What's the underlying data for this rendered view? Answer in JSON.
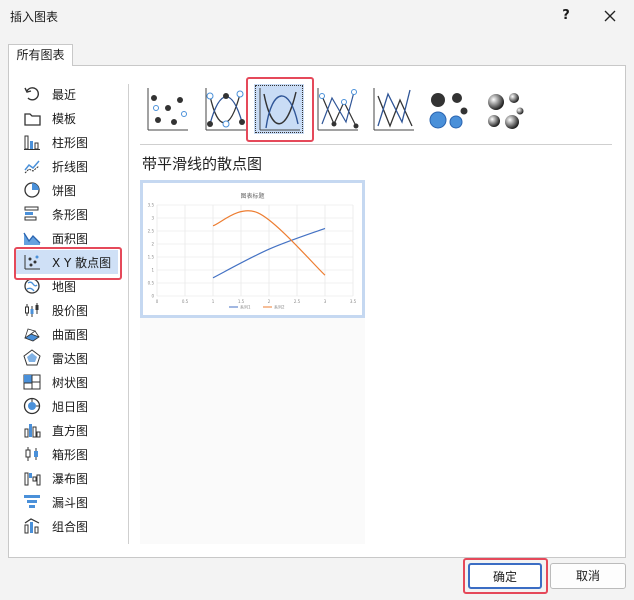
{
  "dialog": {
    "title": "插入图表",
    "help_label": "?",
    "tab_label": "所有图表"
  },
  "sidebar": {
    "items": [
      {
        "label": "最近",
        "icon": "recent-icon"
      },
      {
        "label": "模板",
        "icon": "template-folder-icon"
      },
      {
        "label": "柱形图",
        "icon": "column-chart-icon"
      },
      {
        "label": "折线图",
        "icon": "line-chart-icon"
      },
      {
        "label": "饼图",
        "icon": "pie-chart-icon"
      },
      {
        "label": "条形图",
        "icon": "bar-chart-icon"
      },
      {
        "label": "面积图",
        "icon": "area-chart-icon"
      },
      {
        "label": "X Y 散点图",
        "icon": "scatter-chart-icon"
      },
      {
        "label": "地图",
        "icon": "map-chart-icon"
      },
      {
        "label": "股价图",
        "icon": "stock-chart-icon"
      },
      {
        "label": "曲面图",
        "icon": "surface-chart-icon"
      },
      {
        "label": "雷达图",
        "icon": "radar-chart-icon"
      },
      {
        "label": "树状图",
        "icon": "treemap-chart-icon"
      },
      {
        "label": "旭日图",
        "icon": "sunburst-chart-icon"
      },
      {
        "label": "直方图",
        "icon": "histogram-chart-icon"
      },
      {
        "label": "箱形图",
        "icon": "box-whisker-chart-icon"
      },
      {
        "label": "瀑布图",
        "icon": "waterfall-chart-icon"
      },
      {
        "label": "漏斗图",
        "icon": "funnel-chart-icon"
      },
      {
        "label": "组合图",
        "icon": "combo-chart-icon"
      }
    ],
    "selected_index": 7
  },
  "subtypes": {
    "items": [
      "scatter-markers-icon",
      "scatter-smooth-lines-markers-icon",
      "scatter-smooth-lines-icon",
      "scatter-straight-lines-markers-icon",
      "scatter-straight-lines-icon",
      "bubble-icon",
      "bubble-3d-icon"
    ],
    "selected_index": 2,
    "selected_title": "带平滑线的散点图"
  },
  "preview": {
    "chart_data": {
      "type": "line",
      "title": "图表标题",
      "x_ticks": [
        "0",
        "0.5",
        "1",
        "1.5",
        "2",
        "2.5",
        "3",
        "3.5"
      ],
      "y_ticks": [
        "0",
        "0.5",
        "1",
        "1.5",
        "2",
        "2.5",
        "3",
        "3.5"
      ],
      "xlim": [
        0,
        3.5
      ],
      "ylim": [
        0,
        3.5
      ],
      "grid": true,
      "legend_position": "bottom",
      "series": [
        {
          "name": "系列1",
          "color": "#4472c4",
          "x": [
            1,
            2,
            3
          ],
          "y": [
            0.7,
            1.8,
            2.6
          ]
        },
        {
          "name": "系列2",
          "color": "#ed7d31",
          "x": [
            1,
            1.8,
            3
          ],
          "y": [
            2.7,
            3.2,
            0.8
          ]
        }
      ]
    }
  },
  "footer": {
    "ok_label": "确定",
    "cancel_label": "取消"
  },
  "colors": {
    "accent": "#3b6dc4",
    "highlight": "#e5495a",
    "selection": "#cfe0f6"
  }
}
